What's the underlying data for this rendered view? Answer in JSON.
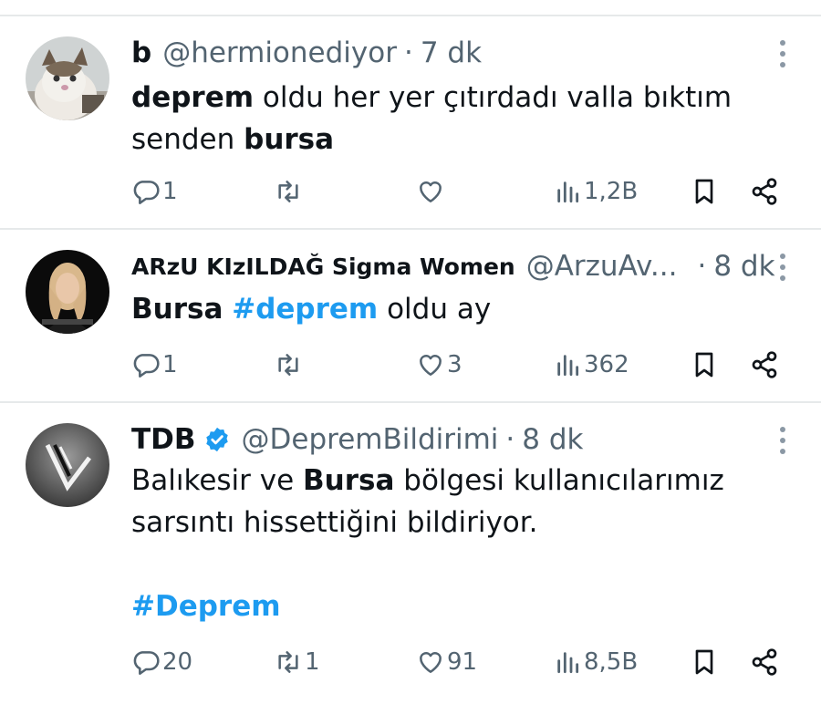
{
  "tweets": [
    {
      "name": "b",
      "handle": "@hermionediyor",
      "separator": "·",
      "time": "7 dk",
      "text_parts": [
        "deprem",
        " oldu her yer çıtırdadı valla bıktım senden ",
        "bursa"
      ],
      "avatar": "cat-avatar",
      "replies": "1",
      "retweets": "",
      "likes": "",
      "views": "1,2B"
    },
    {
      "name": "ARzU KIzILDAĞ Sigma Women",
      "handle": "@ArzuAv...",
      "separator": "·",
      "time": "8 dk",
      "text_parts": [
        "Bursa",
        " ",
        "#deprem",
        " oldu ay"
      ],
      "avatar": "woman-avatar",
      "replies": "1",
      "retweets": "",
      "likes": "3",
      "views": "362"
    },
    {
      "name": "TDB",
      "handle": "@DepremBildirimi",
      "separator": "·",
      "time": "8 dk",
      "verified": true,
      "text_parts": [
        "Balıkesir ve ",
        "Bursa",
        " bölgesi kullanıcılarımız sarsıntı hissettiğini bildiriyor.",
        "#Deprem"
      ],
      "avatar": "tdb-logo-avatar",
      "replies": "20",
      "retweets": "1",
      "likes": "91",
      "views": "8,5B"
    }
  ],
  "colors": {
    "accent": "#1d9bf0",
    "text": "#0f1419",
    "muted": "#536471",
    "divider": "#e6e9ea"
  },
  "icons": [
    "reply-icon",
    "retweet-icon",
    "like-icon",
    "views-icon",
    "bookmark-icon",
    "share-icon",
    "more-icon",
    "verified-badge-icon"
  ]
}
